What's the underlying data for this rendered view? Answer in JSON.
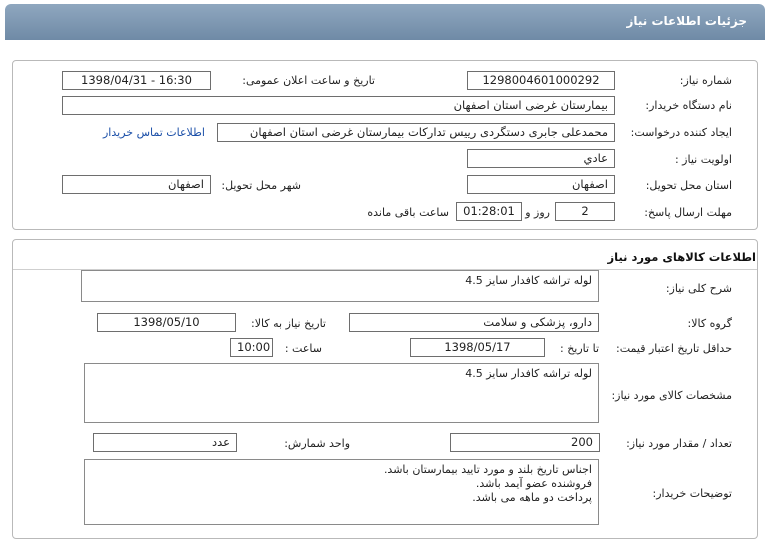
{
  "header": {
    "title": "جزئیات اطلاعات نیاز"
  },
  "info": {
    "need_number_label": "شماره نیاز:",
    "need_number": "1298004601000292",
    "announce_label": "تاریخ و ساعت اعلان عمومی:",
    "announce_value": "1398/04/31 - 16:30",
    "buyer_label": "نام دستگاه خریدار:",
    "buyer_value": "بیمارستان غرضی استان اصفهان",
    "creator_label": "ایجاد کننده درخواست:",
    "creator_value": "محمدعلی جابری دستگردی رییس تدارکات بیمارستان غرضی استان اصفهان",
    "contact_link": "اطلاعات تماس خریدار",
    "priority_label": "اولویت نیاز :",
    "priority_value": "عادي",
    "province_label": "استان محل تحویل:",
    "province_value": "اصفهان",
    "city_label": "شهر محل تحویل:",
    "city_value": "اصفهان",
    "deadline_label": "مهلت ارسال پاسخ:",
    "days_value": "2",
    "days_text": "روز و",
    "time_value": "01:28:01",
    "remaining_text": "ساعت باقی مانده"
  },
  "goods": {
    "section_title": "اطلاعات کالاهای مورد نیاز",
    "summary_label": "شرح کلی نیاز:",
    "summary_value": "لوله تراشه کافدار سایز 4.5",
    "group_label": "گروه کالا:",
    "group_value": "دارو، پزشکی و سلامت",
    "need_date_label": "تاریخ نیاز به کالا:",
    "need_date_value": "1398/05/10",
    "min_price_label": "حداقل تاریخ اعتبار قیمت:",
    "until_date_label": "تا تاریخ :",
    "until_date_value": "1398/05/17",
    "hour_label": "ساعت :",
    "hour_value": "10:00",
    "specs_label": "مشخصات کالای مورد نیاز:",
    "specs_value": "لوله تراشه کافدار سایز 4.5",
    "qty_label": "تعداد / مقدار مورد نیاز:",
    "qty_value": "200",
    "unit_label": "واحد شمارش:",
    "unit_value": "عدد",
    "desc_label": "توضیحات خریدار:",
    "desc_lines": [
      "اجناس تاریخ بلند و مورد تایید بیمارستان باشد.",
      "فروشنده عضو آیمد باشد.",
      "پرداخت دو ماهه می باشد."
    ]
  }
}
